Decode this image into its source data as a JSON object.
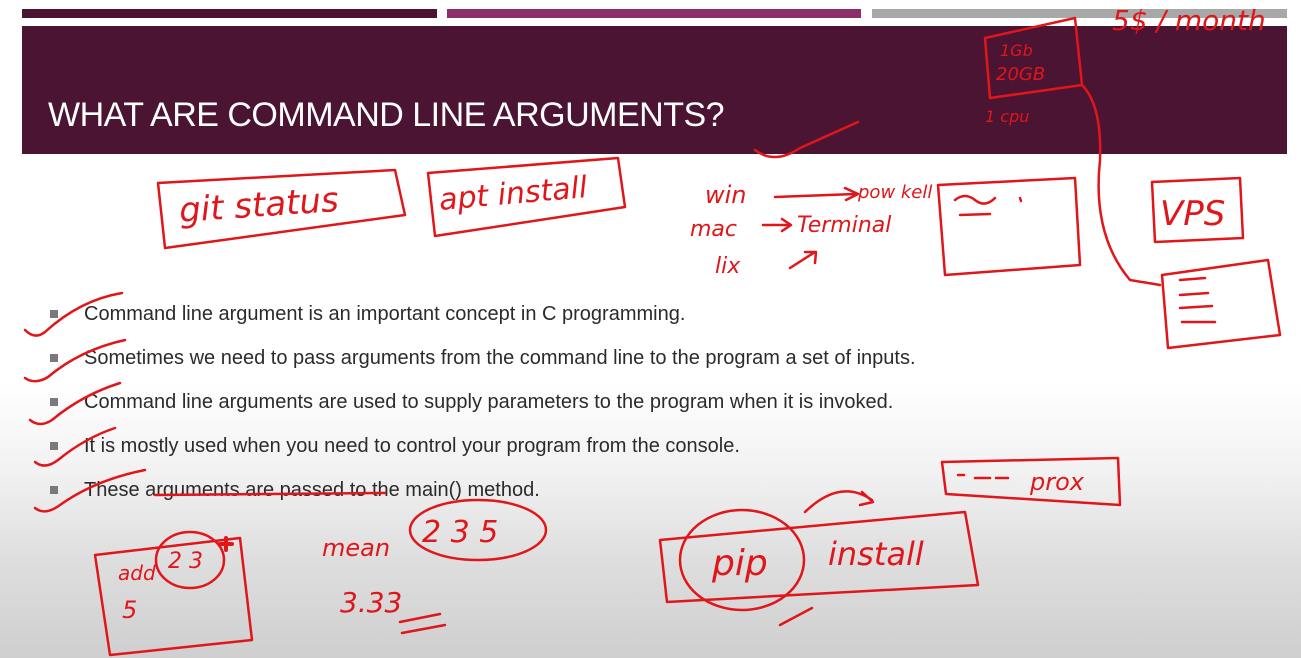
{
  "slide": {
    "title": "WHAT ARE COMMAND LINE ARGUMENTS?",
    "bullets": [
      "Command line argument is an important concept in C programming.",
      "Sometimes we need to pass arguments from the command line to the program a set of inputs.",
      "Command line arguments are used to supply parameters to the program when it is invoked.",
      "It is mostly used when you need to control your program from the console.",
      "These arguments are passed to the main() method."
    ]
  },
  "annotations": {
    "ink_color": "#e0161a",
    "git_status": "git status",
    "apt_install": "apt install",
    "win": "win",
    "pow_kell": "pow kell",
    "mac": "mac",
    "terminal": "Terminal",
    "lix": "lix",
    "price": "5$ / month",
    "ram": "1Gb",
    "disk": "20GB",
    "cpu": "1 cpu",
    "vps": "VPS",
    "add": "add",
    "add_args": "2 3",
    "add_result": "5",
    "mean": "mean",
    "mean_args": "2 3 5",
    "mean_result": "3.33",
    "pip": "pip",
    "install": "install",
    "prox": "prox"
  }
}
